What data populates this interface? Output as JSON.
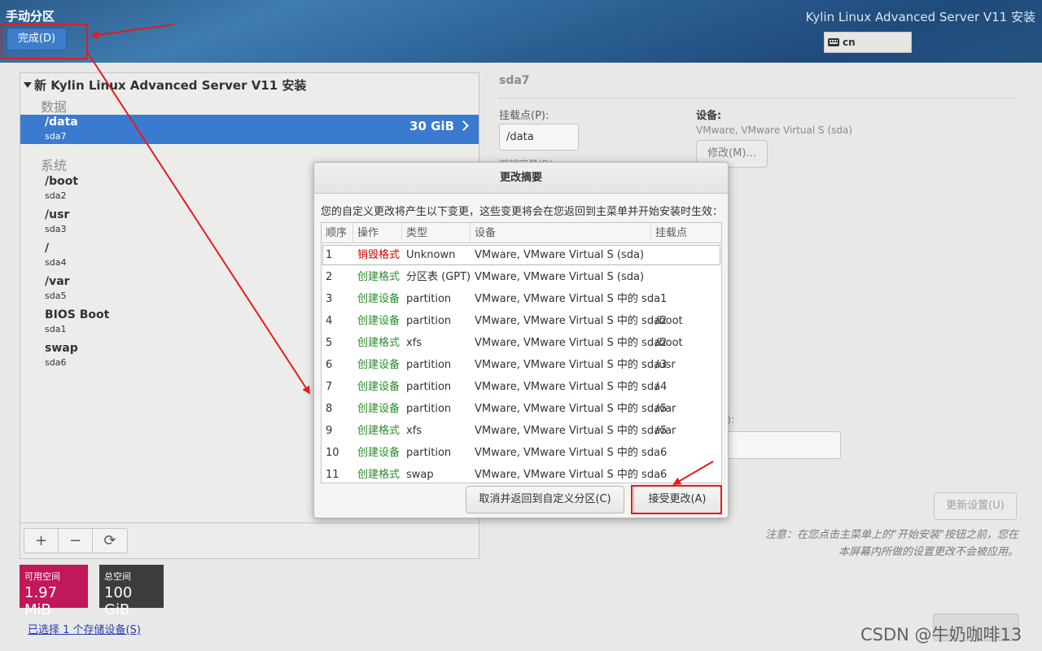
{
  "header": {
    "title": "手动分区",
    "done_label": "完成(D)",
    "product": "Kylin Linux Advanced Server V11 安装",
    "keyboard_layout": "cn"
  },
  "tree": {
    "root_label": "新 Kylin Linux Advanced Server V11 安装",
    "groups": [
      {
        "label": "数据"
      },
      {
        "label": "系统"
      }
    ],
    "selected": {
      "name": "/data",
      "device": "sda7",
      "size": "30 GiB"
    },
    "system_items": [
      {
        "name": "/boot",
        "device": "sda2"
      },
      {
        "name": "/usr",
        "device": "sda3"
      },
      {
        "name": "/",
        "device": "sda4"
      },
      {
        "name": "/var",
        "device": "sda5"
      },
      {
        "name": "BIOS Boot",
        "device": "sda1"
      },
      {
        "name": "swap",
        "device": "sda6"
      }
    ],
    "toolbar": {
      "add": "+",
      "remove": "−",
      "refresh": "⟳"
    }
  },
  "space": {
    "free_label": "可用空间",
    "free_value": "1.97 MiB",
    "total_label": "总空间",
    "total_value": "100 GiB",
    "storage_link": "已选择 1 个存储设备(S)"
  },
  "details": {
    "title": "sda7",
    "mount_point_label": "挂载点(P):",
    "mount_point_value": "/data",
    "device_label": "设备:",
    "device_value": "VMware, VMware Virtual S (sda)",
    "modify_label": "修改(M)...",
    "hidden_label": "期望容量(D):",
    "right_label": "):",
    "update_label": "更新设置(U)",
    "note_line1": "注意：在您点击主菜单上的\"开始安装\"按钮之前，您在",
    "note_line2": "本屏幕内所做的设置更改不会被应用。"
  },
  "dialog": {
    "title": "更改摘要",
    "description": "您的自定义更改将产生以下变更，这些变更将会在您返回到主菜单并开始安装时生效：",
    "columns": [
      "顺序",
      "操作",
      "类型",
      "设备",
      "挂载点"
    ],
    "rows": [
      {
        "num": "1",
        "op": "销毁格式",
        "kind": "destroy",
        "type": "Unknown",
        "device": "VMware, VMware Virtual S (sda)",
        "mount": ""
      },
      {
        "num": "2",
        "op": "创建格式",
        "kind": "create",
        "type": "分区表 (GPT)",
        "device": "VMware, VMware Virtual S (sda)",
        "mount": ""
      },
      {
        "num": "3",
        "op": "创建设备",
        "kind": "create",
        "type": "partition",
        "device": "VMware, VMware Virtual S 中的 sda1",
        "mount": ""
      },
      {
        "num": "4",
        "op": "创建设备",
        "kind": "create",
        "type": "partition",
        "device": "VMware, VMware Virtual S 中的 sda2",
        "mount": "/boot"
      },
      {
        "num": "5",
        "op": "创建格式",
        "kind": "create",
        "type": "xfs",
        "device": "VMware, VMware Virtual S 中的 sda2",
        "mount": "/boot"
      },
      {
        "num": "6",
        "op": "创建设备",
        "kind": "create",
        "type": "partition",
        "device": "VMware, VMware Virtual S 中的 sda3",
        "mount": "/usr"
      },
      {
        "num": "7",
        "op": "创建设备",
        "kind": "create",
        "type": "partition",
        "device": "VMware, VMware Virtual S 中的 sda4",
        "mount": "/"
      },
      {
        "num": "8",
        "op": "创建设备",
        "kind": "create",
        "type": "partition",
        "device": "VMware, VMware Virtual S 中的 sda5",
        "mount": "/var"
      },
      {
        "num": "9",
        "op": "创建格式",
        "kind": "create",
        "type": "xfs",
        "device": "VMware, VMware Virtual S 中的 sda5",
        "mount": "/var"
      },
      {
        "num": "10",
        "op": "创建设备",
        "kind": "create",
        "type": "partition",
        "device": "VMware, VMware Virtual S 中的 sda6",
        "mount": ""
      },
      {
        "num": "11",
        "op": "创建格式",
        "kind": "create",
        "type": "swap",
        "device": "VMware, VMware Virtual S 中的 sda6",
        "mount": ""
      }
    ],
    "cancel_label": "取消并返回到自定义分区(C)",
    "accept_label": "接受更改(A)"
  },
  "colors": {
    "destroy": "#cc0000",
    "create": "#2a8a2a",
    "selection": "#3a7bd0",
    "annotation": "#e31c1c"
  },
  "watermark": "CSDN @牛奶咖啡13"
}
